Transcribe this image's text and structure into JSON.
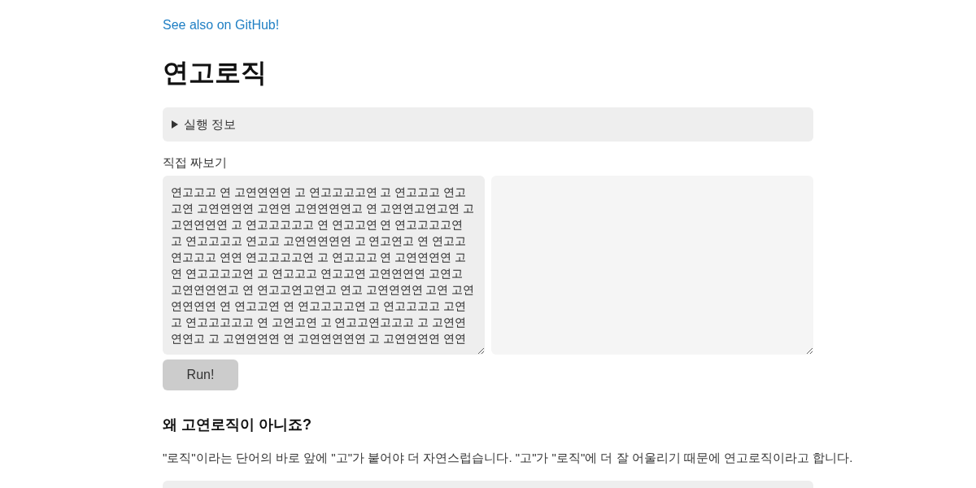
{
  "link": {
    "text": "See also on GitHub!"
  },
  "title": "연고로직",
  "details": {
    "summary": "실행 정보",
    "expanded": false
  },
  "editor": {
    "label": "직접 짜보기",
    "code_lines": [
      "연고고고 연 고연연연연 고 연고고고고연 고 연고고고 연고",
      "고연 고연연연연 고연연 고연연연연고 연 고연연고연고연 고",
      "고연연연연 고 연고고고고고 연 연고고연 연 연고고고고연",
      "고 연고고고고 연고고 고연연연연연 고 연고연고 연 연고고",
      "연고고고 연연 연고고고고연 고 연고고고 연 고연연연연 고",
      "연 연고고고고연 고 연고고고 연고고연 고연연연연 고연고",
      "고연연연연고 연 연고고연고연고 연고 고연연연연 고연 고연",
      "연연연연 연 연고고연 연 연고고고고연 고 연고고고고 고연",
      "고 연고고고고고 연 고연고연 고 연고고연고고고 고 고연연",
      "연연고 고 고연연연연 연 고연연연연연 고 고연연연연 연연"
    ]
  },
  "run_button": {
    "label": "Run!"
  },
  "faq": {
    "heading": "왜 고연로직이 아니죠?",
    "paragraph": "\"로직\"이라는 단어의 바로 앞에 \"고\"가 붙어야 더 자연스럽습니다. \"고\"가 \"로직\"에 더 잘 어울리기 때문에 연고로직이라고 합니다."
  }
}
